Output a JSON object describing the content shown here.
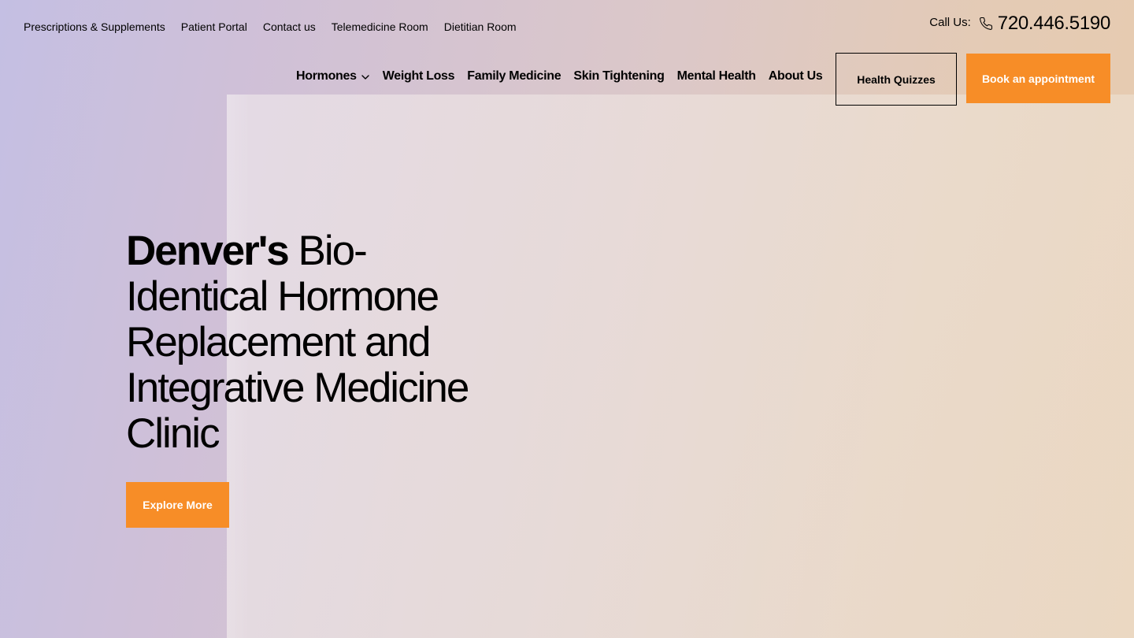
{
  "utility_nav": {
    "items": [
      {
        "label": "Prescriptions & Supplements"
      },
      {
        "label": "Patient Portal"
      },
      {
        "label": "Contact us"
      },
      {
        "label": "Telemedicine Room"
      },
      {
        "label": "Dietitian Room"
      }
    ]
  },
  "contact": {
    "call_label": "Call Us:",
    "phone_icon": "phone-icon",
    "phone_number": "720.446.5190"
  },
  "main_nav": {
    "items": [
      {
        "label": "Hormones",
        "has_dropdown": true
      },
      {
        "label": "Weight Loss"
      },
      {
        "label": "Family Medicine"
      },
      {
        "label": "Skin Tightening"
      },
      {
        "label": "Mental Health"
      },
      {
        "label": "About Us"
      }
    ],
    "quiz_button": "Health Quizzes",
    "book_button": "Book an appointment"
  },
  "hero": {
    "heading_strong": "Denver's",
    "heading_rest": " Bio-Identical Hormone Replacement and Integrative Medicine Clinic",
    "cta_label": "Explore More"
  },
  "colors": {
    "accent": "#f78d27",
    "text": "#000000",
    "button_text": "#ffffff"
  }
}
